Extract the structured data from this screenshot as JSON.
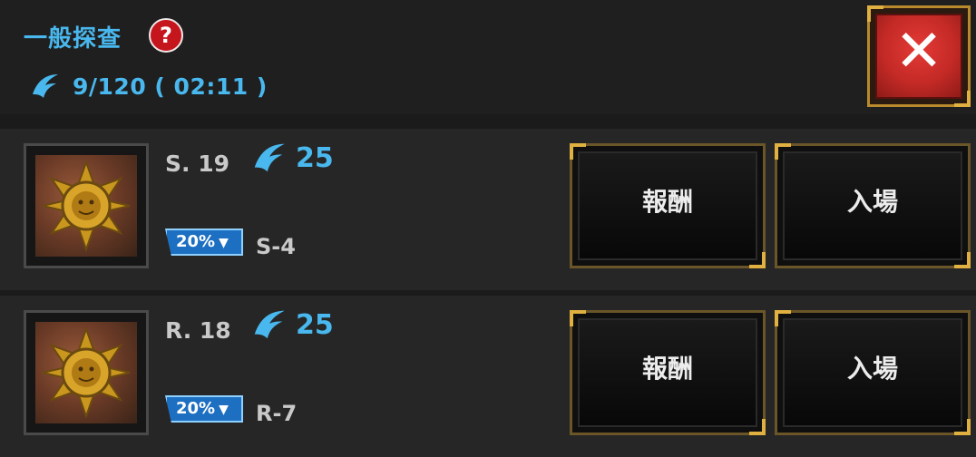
{
  "header": {
    "title": "一般探查",
    "help_label": "?",
    "stamina": "9/120 ( 02:11 )",
    "close_label": "✕"
  },
  "rows": [
    {
      "stage": "S. 19",
      "cost": "25",
      "badge": "20%",
      "rank": "S-4",
      "reward_label": "報酬",
      "enter_label": "入場"
    },
    {
      "stage": "R. 18",
      "cost": "25",
      "badge": "20%",
      "rank": "R-7",
      "reward_label": "報酬",
      "enter_label": "入場"
    }
  ],
  "colors": {
    "accent": "#49b8ee",
    "close": "#c42a26",
    "gold": "#e0b040"
  },
  "icons": [
    "wing-icon",
    "help-icon",
    "close-icon",
    "sun-emblem-icon",
    "dropdown-arrow-icon"
  ]
}
